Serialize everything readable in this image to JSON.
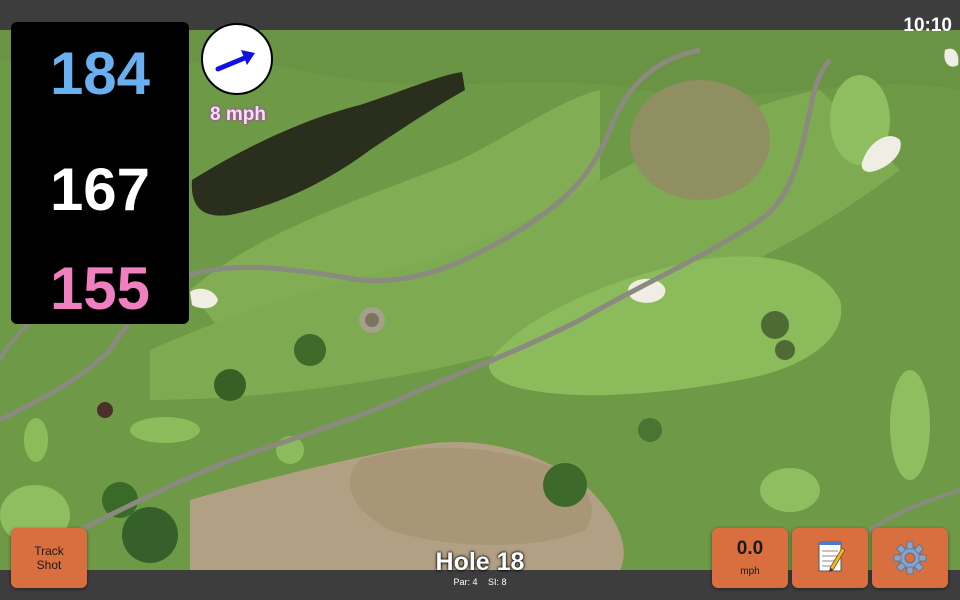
{
  "status": {
    "time": "10:10"
  },
  "distances": {
    "back": "184",
    "middle": "167",
    "front": "155",
    "colors": {
      "back": "#6aaff0",
      "middle": "#ffffff",
      "front": "#f07fc0"
    }
  },
  "wind": {
    "speed": "8 mph",
    "direction_icon": "wind-arrow-icon"
  },
  "buttons": {
    "track_shot_line1": "Track",
    "track_shot_line2": "Shot",
    "speed_value": "0.0",
    "speed_unit": "mph",
    "notes_icon": "notepad-icon",
    "settings_icon": "gear-icon"
  },
  "hole": {
    "title": "Hole 18",
    "par": "Par: 4",
    "si": "SI: 8"
  },
  "colors": {
    "accent_button": "#d96f3f",
    "panel": "#000000"
  }
}
